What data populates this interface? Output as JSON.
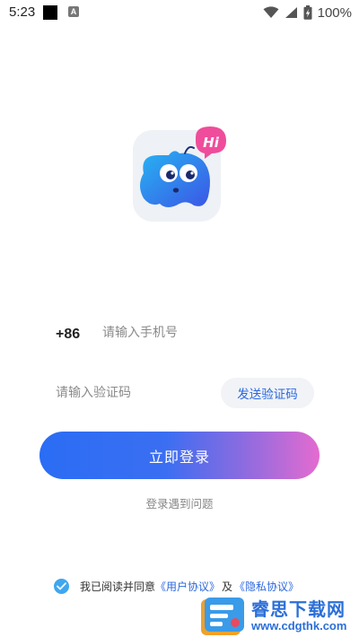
{
  "status_bar": {
    "time": "5:23",
    "battery_text": "100%",
    "notification_icon_letter": "A"
  },
  "logo": {
    "badge_text": "Hi"
  },
  "form": {
    "country_code": "+86",
    "phone_placeholder": "请输入手机号",
    "code_placeholder": "请输入验证码",
    "send_code_label": "发送验证码",
    "login_label": "立即登录",
    "help_label": "登录遇到问题"
  },
  "agreement": {
    "checked": true,
    "prefix": "我已阅读并同意",
    "user_agreement": "《用户协议》",
    "and": "及",
    "privacy_policy": "《隐私协议》"
  },
  "watermark": {
    "title": "睿思下载网",
    "url": "www.cdgthk.com"
  },
  "colors": {
    "accent_blue": "#2a67e0",
    "button_gradient_start": "#2a6df4",
    "button_gradient_end": "#e46bd0",
    "check_blue": "#3fa6ef"
  }
}
